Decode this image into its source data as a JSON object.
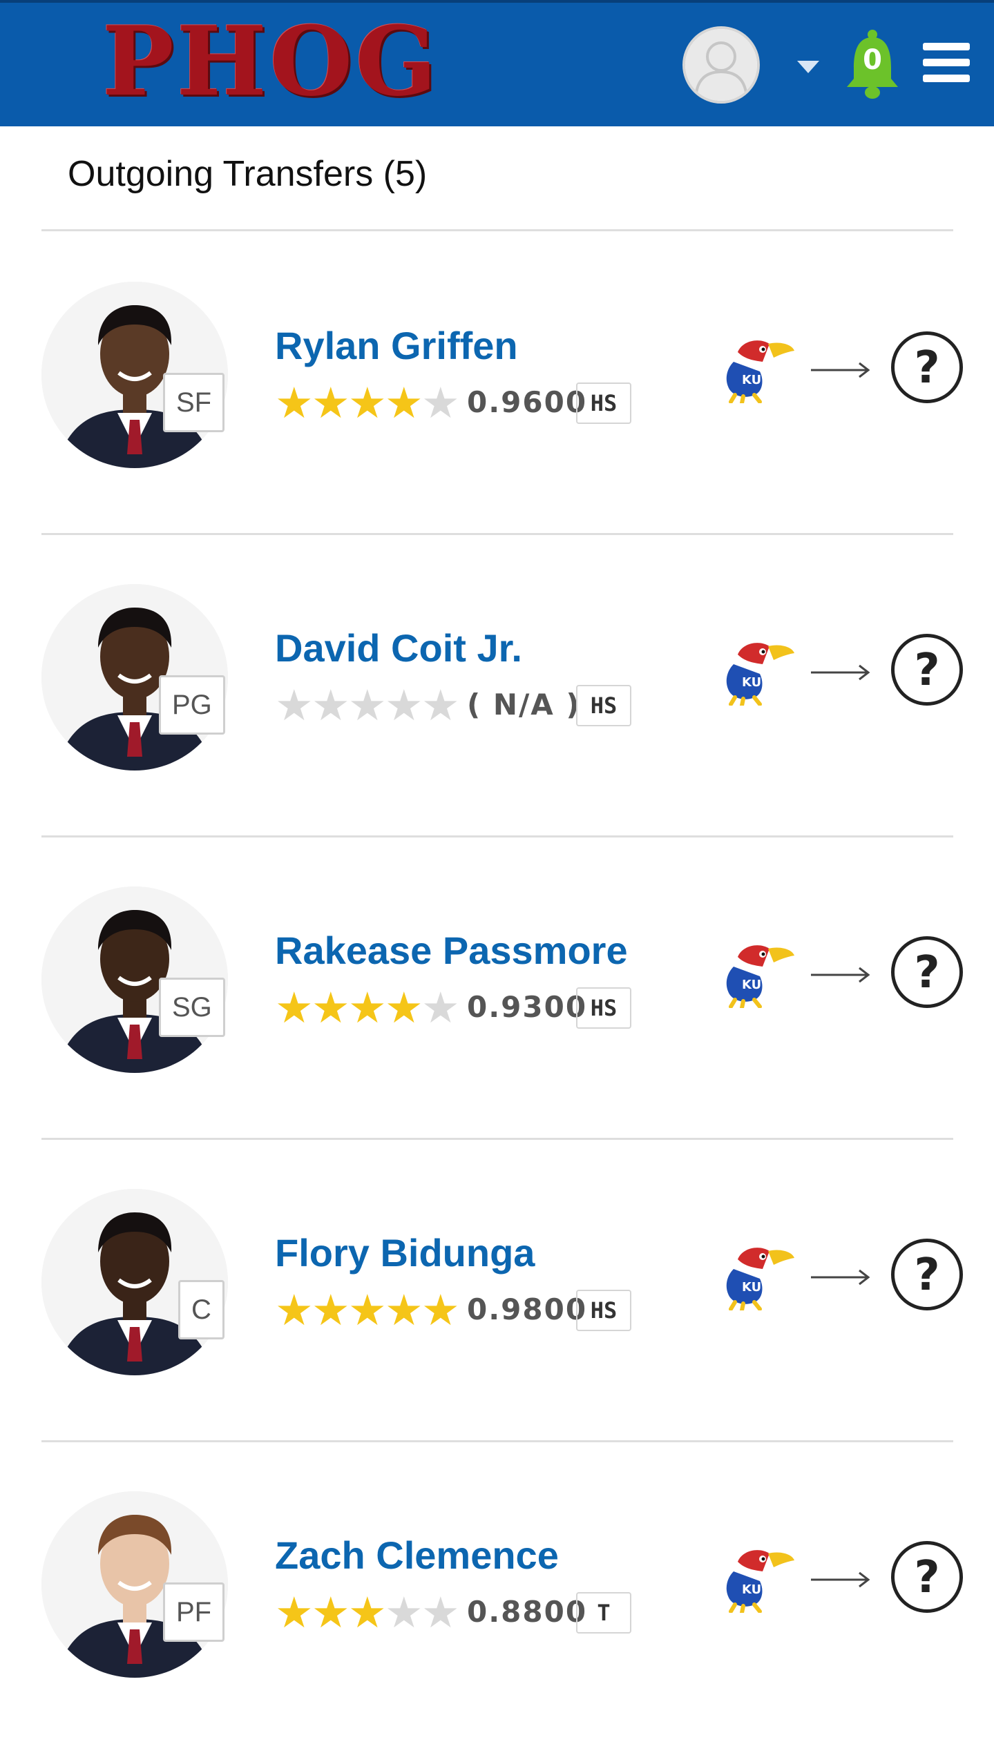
{
  "header": {
    "logo_text": "PHOG",
    "notification_count": "0",
    "brand_color": "#0a5bab",
    "logo_color": "#a3141d",
    "bell_color": "#6cc22a"
  },
  "section": {
    "title": "Outgoing Transfers (5)"
  },
  "players": [
    {
      "name": "Rylan Griffen",
      "position": "SF",
      "rating": "0.9600",
      "stars": 4,
      "source": "HS",
      "destination": "?"
    },
    {
      "name": "David Coit Jr.",
      "position": "PG",
      "rating": "( N/A )",
      "stars": 0,
      "source": "HS",
      "destination": "?"
    },
    {
      "name": "Rakease Passmore",
      "position": "SG",
      "rating": "0.9300",
      "stars": 4,
      "source": "HS",
      "destination": "?"
    },
    {
      "name": "Flory Bidunga",
      "position": "C",
      "rating": "0.9800",
      "stars": 5,
      "source": "HS",
      "destination": "?"
    },
    {
      "name": "Zach Clemence",
      "position": "PF",
      "rating": "0.8800",
      "stars": 3,
      "source": "T",
      "destination": "?"
    }
  ],
  "icons": {
    "avatar": "user-avatar-icon",
    "caret": "caret-down-icon",
    "bell": "bell-icon",
    "menu": "hamburger-menu-icon",
    "school": "jayhawk-logo-icon",
    "arrow": "arrow-right-icon",
    "unknown": "question-mark-icon"
  },
  "colors": {
    "name": "#0c66b0",
    "star_on": "#f5c518",
    "star_off": "#d9d9d9"
  }
}
